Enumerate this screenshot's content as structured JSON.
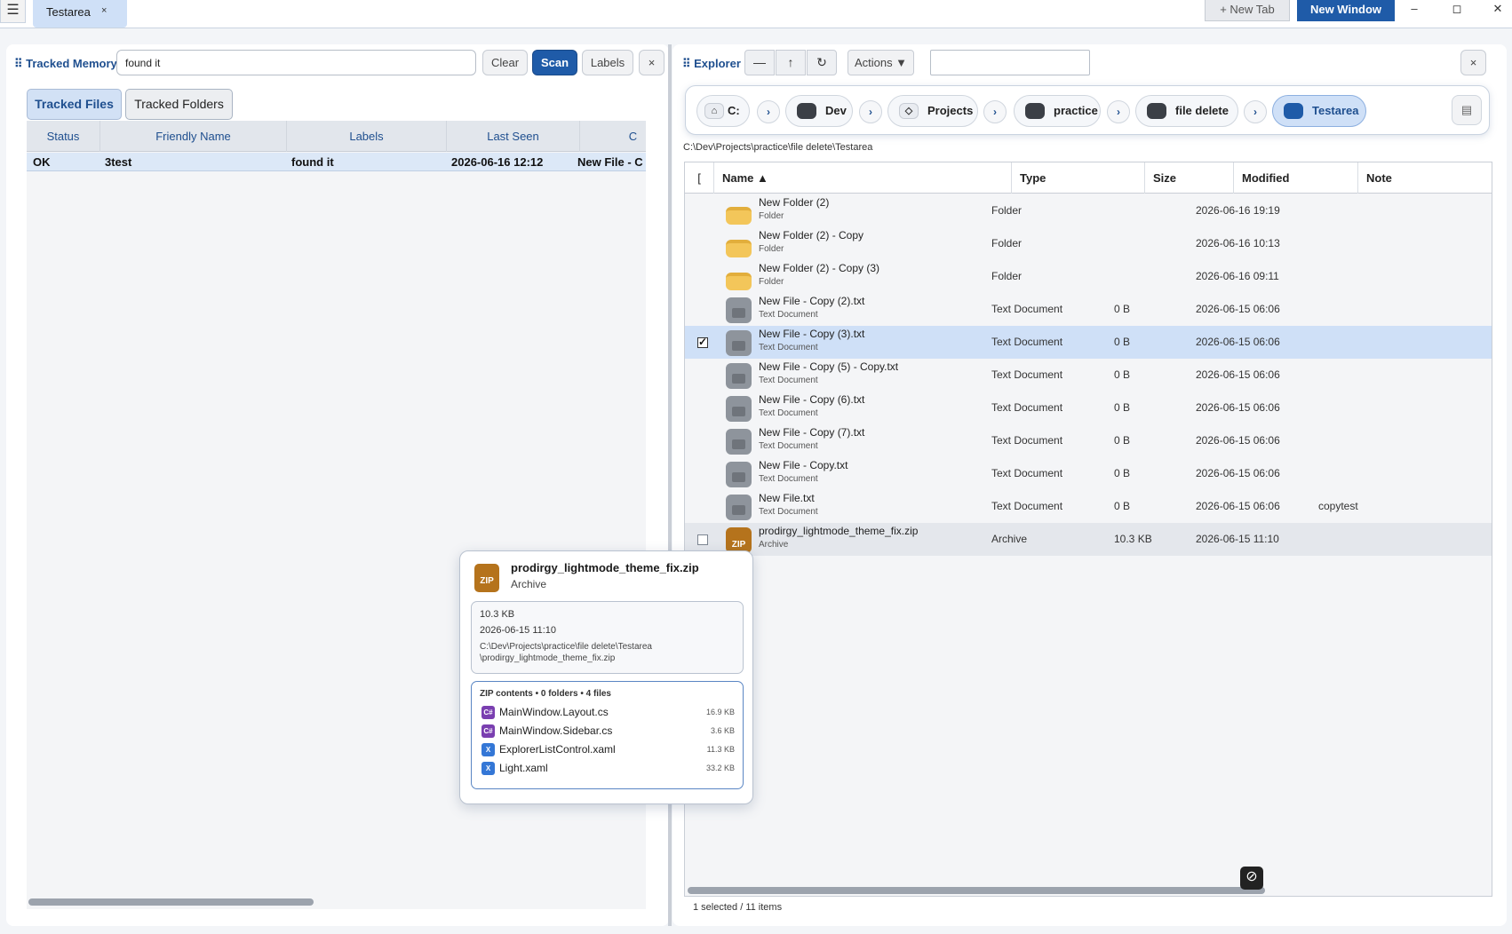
{
  "window": {
    "tab_label": "Testarea",
    "tab_close": "×",
    "menu_icon": "☰",
    "new_tab": "+ New Tab",
    "new_window": "New Window",
    "minimize": "–",
    "maximize": "◻",
    "close": "✕"
  },
  "tracked": {
    "title": "⠿ Tracked Memory",
    "search_value": "found it",
    "buttons": {
      "clear": "Clear",
      "scan": "Scan",
      "labels": "Labels",
      "close": "×"
    },
    "tabs": {
      "files": "Tracked Files",
      "folders": "Tracked Folders"
    },
    "columns": [
      "Status",
      "Friendly Name",
      "Labels",
      "Last Seen",
      "C"
    ],
    "rows": [
      {
        "status": "OK",
        "friendly_name": "3test",
        "labels": "found it",
        "last_seen": "2026-06-16 12:12",
        "c": "New File - C"
      }
    ]
  },
  "explorer": {
    "title": "⠿ Explorer",
    "buttons": {
      "back": "—",
      "up": "↑",
      "refresh": "↻",
      "actions": "Actions ▼",
      "close": "×"
    },
    "filter_value": "",
    "breadcrumb": {
      "drive": "C:",
      "items": [
        "Dev",
        "Projects",
        "practice",
        "file delete",
        "Testarea"
      ],
      "separator": "›",
      "home_icon": "⌂",
      "projects_icon": "◇",
      "end_icon": "▤"
    },
    "path": "C:\\Dev\\Projects\\practice\\file delete\\Testarea",
    "columns": {
      "check": "[",
      "name": "Name ▲",
      "type": "Type",
      "size": "Size",
      "modified": "Modified",
      "note": "Note"
    },
    "files": [
      {
        "name": "New Folder (2)",
        "kind": "Folder",
        "type": "Folder",
        "size": "",
        "modified": "2026-06-16 19:19",
        "note": "",
        "icon": "folder",
        "state": ""
      },
      {
        "name": "New Folder (2) - Copy",
        "kind": "Folder",
        "type": "Folder",
        "size": "",
        "modified": "2026-06-16 10:13",
        "note": "",
        "icon": "folder",
        "state": ""
      },
      {
        "name": "New Folder (2) - Copy (3)",
        "kind": "Folder",
        "type": "Folder",
        "size": "",
        "modified": "2026-06-16 09:11",
        "note": "",
        "icon": "folder",
        "state": ""
      },
      {
        "name": "New File - Copy (2).txt",
        "kind": "Text Document",
        "type": "Text Document",
        "size": "0 B",
        "modified": "2026-06-15 06:06",
        "note": "",
        "icon": "text",
        "state": ""
      },
      {
        "name": "New File - Copy (3).txt",
        "kind": "Text Document",
        "type": "Text Document",
        "size": "0 B",
        "modified": "2026-06-15 06:06",
        "note": "",
        "icon": "text",
        "state": "selected"
      },
      {
        "name": "New File - Copy (5) - Copy.txt",
        "kind": "Text Document",
        "type": "Text Document",
        "size": "0 B",
        "modified": "2026-06-15 06:06",
        "note": "",
        "icon": "text",
        "state": ""
      },
      {
        "name": "New File - Copy (6).txt",
        "kind": "Text Document",
        "type": "Text Document",
        "size": "0 B",
        "modified": "2026-06-15 06:06",
        "note": "",
        "icon": "text",
        "state": ""
      },
      {
        "name": "New File - Copy (7).txt",
        "kind": "Text Document",
        "type": "Text Document",
        "size": "0 B",
        "modified": "2026-06-15 06:06",
        "note": "",
        "icon": "text",
        "state": ""
      },
      {
        "name": "New File - Copy.txt",
        "kind": "Text Document",
        "type": "Text Document",
        "size": "0 B",
        "modified": "2026-06-15 06:06",
        "note": "",
        "icon": "text",
        "state": ""
      },
      {
        "name": "New File.txt",
        "kind": "Text Document",
        "type": "Text Document",
        "size": "0 B",
        "modified": "2026-06-15 06:06",
        "note": "copytest",
        "icon": "text",
        "state": ""
      },
      {
        "name": "prodirgy_lightmode_theme_fix.zip",
        "kind": "Archive",
        "type": "Archive",
        "size": "10.3 KB",
        "modified": "2026-06-15 11:10",
        "note": "",
        "icon": "zip",
        "state": "hover"
      }
    ],
    "status": "1 selected / 11 items",
    "no_icon": "⊘"
  },
  "popup": {
    "zip_badge": "ZIP",
    "name": "prodirgy_lightmode_theme_fix.zip",
    "kind": "Archive",
    "size": "10.3 KB",
    "modified": "2026-06-15 11:10",
    "path_line1": "C:\\Dev\\Projects\\practice\\file delete\\Testarea",
    "path_line2": "\\prodirgy_lightmode_theme_fix.zip",
    "zip_header": "ZIP contents • 0 folders • 4 files",
    "entries": [
      {
        "name": "MainWindow.Layout.cs",
        "size": "16.9 KB",
        "icon": "C#",
        "kind": "cs"
      },
      {
        "name": "MainWindow.Sidebar.cs",
        "size": "3.6 KB",
        "icon": "C#",
        "kind": "cs"
      },
      {
        "name": "ExplorerListControl.xaml",
        "size": "11.3 KB",
        "icon": "X",
        "kind": "xaml"
      },
      {
        "name": "Light.xaml",
        "size": "33.2 KB",
        "icon": "X",
        "kind": "xaml"
      }
    ]
  },
  "colors": {
    "accent": "#1f5ba8",
    "selection": "#cfe0f7",
    "zip": "#b5731c",
    "folder": "#f3c65a"
  }
}
